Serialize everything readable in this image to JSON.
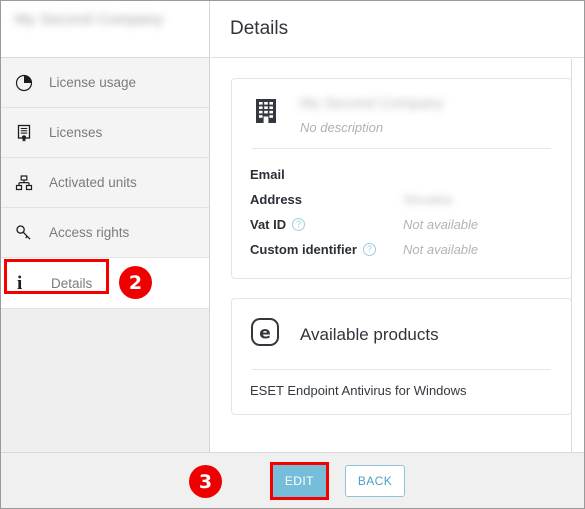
{
  "sidebar": {
    "company_title": "My Second Company",
    "company_title_redacted": true,
    "items": [
      {
        "label": "License usage",
        "icon": "pie-chart-icon",
        "selected": false
      },
      {
        "label": "Licenses",
        "icon": "license-certificate-icon",
        "selected": false
      },
      {
        "label": "Activated units",
        "icon": "org-tree-icon",
        "selected": false
      },
      {
        "label": "Access rights",
        "icon": "key-icon",
        "selected": false
      },
      {
        "label": "Details",
        "icon": "info-icon",
        "selected": true
      }
    ]
  },
  "main": {
    "header": {
      "title": "Details"
    },
    "company_card": {
      "icon": "office-building-icon",
      "name": "My Second Company",
      "name_redacted": true,
      "description": "No description",
      "fields": [
        {
          "label": "Email",
          "value": "",
          "help": false
        },
        {
          "label": "Address",
          "value": "Slovakia",
          "help": false,
          "redacted": true
        },
        {
          "label": "Vat ID",
          "value": "Not available",
          "help": true,
          "help_icon": "question-mark-icon"
        },
        {
          "label": "Custom identifier",
          "value": "Not available",
          "help": true,
          "help_icon": "question-mark-icon"
        }
      ]
    },
    "products_card": {
      "icon": "eset-logo-icon",
      "title": "Available products",
      "items": [
        "ESET Endpoint Antivirus for Windows"
      ]
    }
  },
  "footer": {
    "edit_label": "EDIT",
    "back_label": "BACK"
  },
  "annotations": {
    "badge_2": "2",
    "badge_3": "3",
    "highlight_color": "#f40000",
    "badge_color": "#ee0000"
  },
  "colors": {
    "accent_blue": "#76bdda",
    "back_border": "#8cc4de",
    "sidebar_bg": "#f4f4f4",
    "footer_bg": "#f0f0f0",
    "text_dark": "#30353b",
    "text_muted": "#b3b3b3"
  }
}
